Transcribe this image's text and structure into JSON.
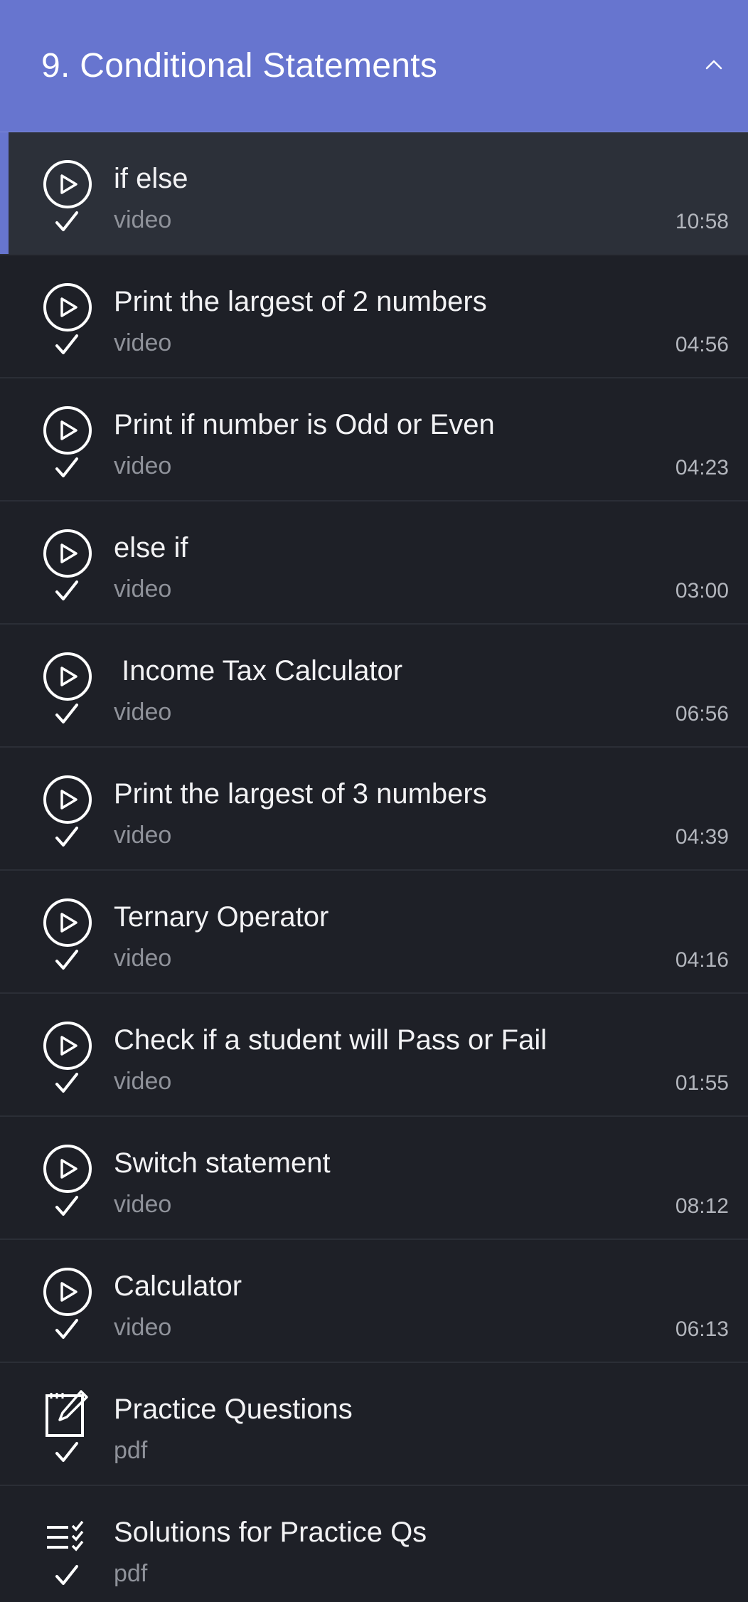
{
  "section": {
    "title": "9. Conditional Statements",
    "collapse_icon": "chevron-up-icon"
  },
  "colors": {
    "header_bg": "#6775cf",
    "list_bg": "#1e2027",
    "active_row_bg": "#2c3039",
    "accent": "#6775cf"
  },
  "lessons": [
    {
      "title": "if else",
      "type": "video",
      "duration": "10:58",
      "icon": "play-circle-icon",
      "completed": true,
      "active": true
    },
    {
      "title": "Print the largest of 2 numbers",
      "type": "video",
      "duration": "04:56",
      "icon": "play-circle-icon",
      "completed": true
    },
    {
      "title": "Print if number is Odd or Even",
      "type": "video",
      "duration": "04:23",
      "icon": "play-circle-icon",
      "completed": true
    },
    {
      "title": "else if",
      "type": "video",
      "duration": "03:00",
      "icon": "play-circle-icon",
      "completed": true
    },
    {
      "title": " Income Tax Calculator",
      "type": "video",
      "duration": "06:56",
      "icon": "play-circle-icon",
      "completed": true
    },
    {
      "title": "Print the largest of 3 numbers",
      "type": "video",
      "duration": "04:39",
      "icon": "play-circle-icon",
      "completed": true
    },
    {
      "title": "Ternary Operator",
      "type": "video",
      "duration": "04:16",
      "icon": "play-circle-icon",
      "completed": true
    },
    {
      "title": "Check if a student will Pass or Fail",
      "type": "video",
      "duration": "01:55",
      "icon": "play-circle-icon",
      "completed": true
    },
    {
      "title": "Switch statement",
      "type": "video",
      "duration": "08:12",
      "icon": "play-circle-icon",
      "completed": true
    },
    {
      "title": "Calculator",
      "type": "video",
      "duration": "06:13",
      "icon": "play-circle-icon",
      "completed": true
    },
    {
      "title": "Practice Questions",
      "type": "pdf",
      "duration": "",
      "icon": "edit-document-icon",
      "completed": true
    },
    {
      "title": "Solutions for Practice Qs",
      "type": "pdf",
      "duration": "",
      "icon": "checklist-icon",
      "completed": true
    }
  ]
}
